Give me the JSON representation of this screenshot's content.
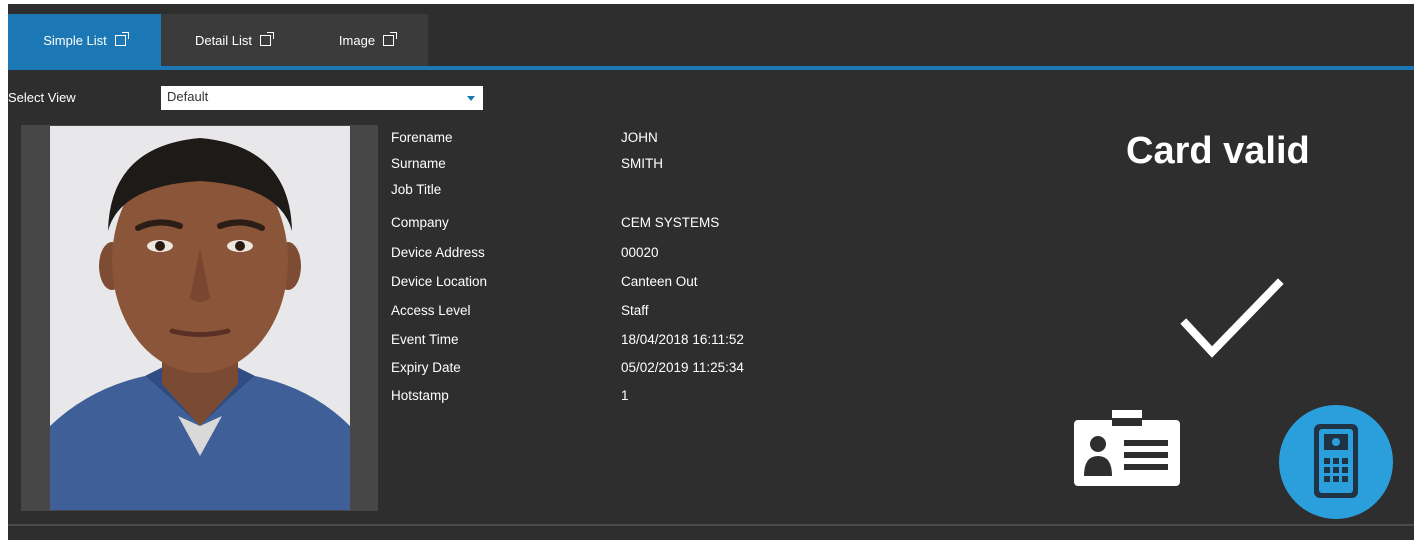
{
  "tabs": [
    {
      "label": "Simple List",
      "active": true
    },
    {
      "label": "Detail List",
      "active": false
    },
    {
      "label": "Image",
      "active": false
    }
  ],
  "view": {
    "label": "Select View",
    "selected": "Default"
  },
  "details": [
    {
      "label": "Forename",
      "value": "JOHN"
    },
    {
      "label": "Surname",
      "value": "SMITH"
    },
    {
      "label": "Job Title",
      "value": ""
    },
    {
      "label": "Company",
      "value": "CEM SYSTEMS"
    },
    {
      "label": "Device Address",
      "value": "00020"
    },
    {
      "label": "Device Location",
      "value": "Canteen Out"
    },
    {
      "label": "Access Level",
      "value": "Staff"
    },
    {
      "label": "Event Time",
      "value": "18/04/2018 16:11:52"
    },
    {
      "label": "Expiry Date",
      "value": "05/02/2019 11:25:34"
    },
    {
      "label": "Hotstamp",
      "value": "1"
    }
  ],
  "status": {
    "text": "Card valid",
    "icons": [
      "check-icon",
      "id-badge-icon",
      "card-reader-icon"
    ]
  },
  "colors": {
    "accent": "#1c78b4",
    "background": "#2e2e2e",
    "tab_inactive": "#3b3b3b"
  }
}
